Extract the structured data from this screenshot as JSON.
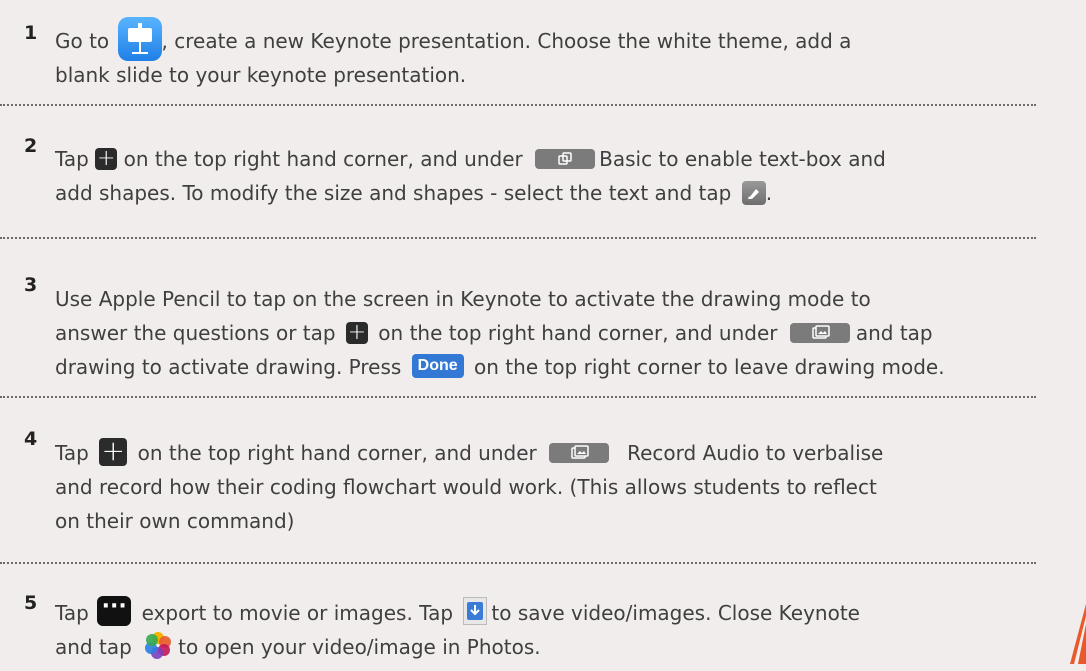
{
  "colors": {
    "background": "#f1edec",
    "text": "#3f3f3f",
    "done_blue": "#3478d6",
    "accent_orange": "#e8592b"
  },
  "steps": [
    {
      "number": "1",
      "parts": [
        "Go to",
        ", create a new Keynote presentation. Choose the white theme, add a",
        "blank slide to your keynote presentation."
      ],
      "icons": [
        "keynote-app-icon"
      ]
    },
    {
      "number": "2",
      "parts": [
        "Tap",
        "on the top right hand corner, and under",
        "Basic to enable text-box and",
        "add shapes. To modify the size and shapes - select the text and tap",
        "."
      ],
      "icons": [
        "plus-icon",
        "shapes-tab-icon",
        "format-brush-icon"
      ]
    },
    {
      "number": "3",
      "parts": [
        "Use Apple Pencil to tap on the screen in Keynote to activate the drawing mode to",
        "answer the questions  or tap",
        "on the top right hand corner, and under",
        "and tap",
        "drawing to activate drawing. Press",
        "on the top right corner to leave drawing mode."
      ],
      "done_label": "Done",
      "icons": [
        "plus-icon",
        "media-tab-icon"
      ]
    },
    {
      "number": "4",
      "parts": [
        "Tap",
        "on the top right hand corner, and under",
        "Record Audio to verbalise",
        "and record how their coding flowchart would work. (This allows students to reflect",
        "on their own command)"
      ],
      "icons": [
        "plus-icon",
        "media-tab-icon"
      ]
    },
    {
      "number": "5",
      "parts": [
        "Tap",
        "export to movie or images. Tap",
        "to save video/images. Close Keynote",
        "and tap",
        "to open your video/image in Photos."
      ],
      "icons": [
        "more-icon",
        "save-download-icon",
        "photos-app-icon"
      ]
    }
  ]
}
